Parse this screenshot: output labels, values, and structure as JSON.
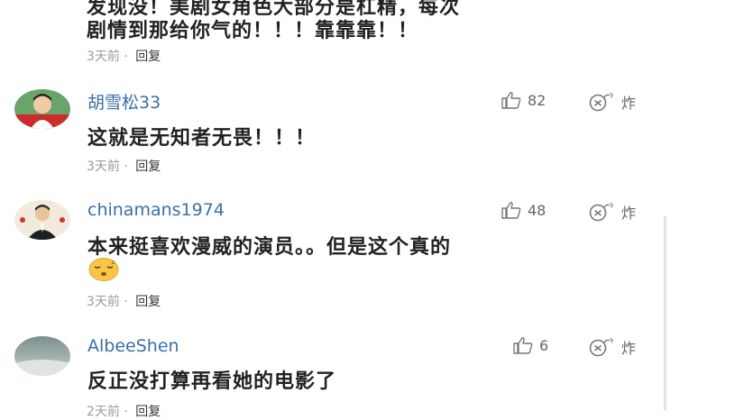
{
  "top_comment": {
    "line1": "发现没！美剧女角色大部分是杠精，每次",
    "line2": "剧情到那给你气的！！！靠靠靠！！",
    "time": "3天前",
    "dot": "·",
    "reply": "回复"
  },
  "comments": [
    {
      "user": "胡雪松33",
      "likes": "82",
      "bomb": "炸",
      "text1": "这就是无知者无畏！！！",
      "text2": "",
      "time": "3天前",
      "dot": "·",
      "reply": "回复"
    },
    {
      "user": "chinamans1974",
      "likes": "48",
      "bomb": "炸",
      "text1": "本来挺喜欢漫威的演员。。但是这个真的",
      "text2": "",
      "time": "3天前",
      "dot": "·",
      "reply": "回复"
    },
    {
      "user": "AlbeeShen",
      "likes": "6",
      "bomb": "炸",
      "text1": "反正没打算再看她的电影了",
      "text2": "",
      "time": "2天前",
      "dot": "·",
      "reply": "回复"
    }
  ]
}
